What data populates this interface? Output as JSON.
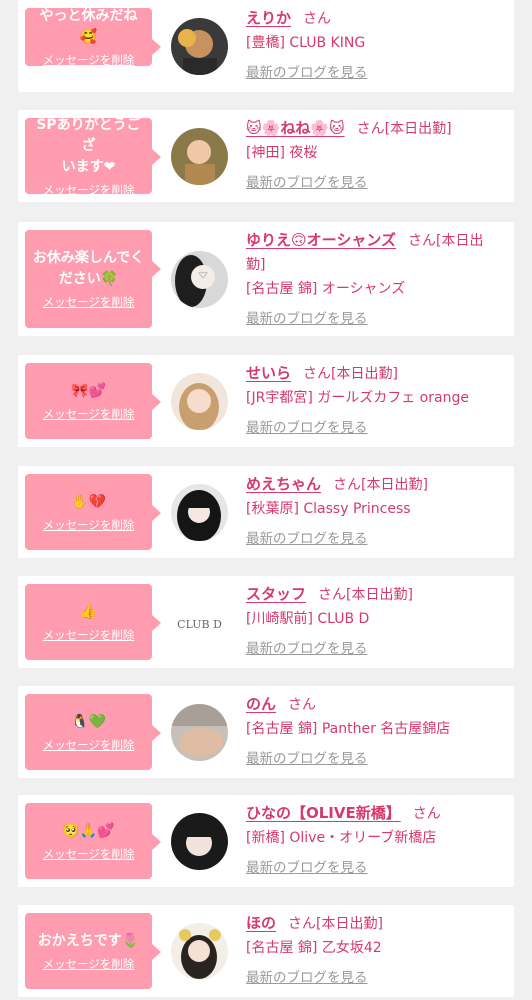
{
  "common": {
    "delete_label": "メッセージを削除",
    "blog_label": "最新のブログを見る",
    "san_label": "さん"
  },
  "cards": [
    {
      "message": "やっと休みだね🥰",
      "name": "えりか",
      "status": "",
      "shop": "[豊橋] CLUB KING",
      "avatar": "photo"
    },
    {
      "message": "SPありがとうござ\nいます❤",
      "name": "🐱🌸ねね🌸🐱",
      "status": "[本日出勤]",
      "shop": "[神田] 夜桜",
      "avatar": "photo"
    },
    {
      "message": "お休み楽しんでく\nださい🍀",
      "name": "ゆりえ🙃オーシャンズ",
      "status": "[本日出勤]",
      "shop": "[名古屋 錦] オーシャンズ",
      "avatar": "photo"
    },
    {
      "message": "🎀💕",
      "name": "せいら",
      "status": "[本日出勤]",
      "shop": "[JR宇都宮] ガールズカフェ orange",
      "avatar": "photo"
    },
    {
      "message": "✋💔",
      "name": "めえちゃん",
      "status": "[本日出勤]",
      "shop": "[秋葉原] Classy Princess",
      "avatar": "photo"
    },
    {
      "message": "👍",
      "name": "スタッフ",
      "status": "[本日出勤]",
      "shop": "[川崎駅前] CLUB D",
      "avatar": "logo",
      "logo_text": "CLUB D"
    },
    {
      "message": "🐧💚",
      "name": "のん",
      "status": "",
      "shop": "[名古屋 錦] Panther 名古屋錦店",
      "avatar": "photo"
    },
    {
      "message": "🥺🙏💕",
      "name": "ひなの【OLIVE新橋】",
      "status": "",
      "shop": "[新橋] Olive・オリーブ新橋店",
      "avatar": "photo"
    },
    {
      "message": "おかえちです🌷",
      "name": "ほの",
      "status": "[本日出勤]",
      "shop": "[名古屋 錦] 乙女坂42",
      "avatar": "photo"
    }
  ],
  "colors": {
    "bubble": "#ff9cb0",
    "name": "#d63a6a",
    "blog_link": "#9a9a9a",
    "background": "#f0f0f0"
  }
}
